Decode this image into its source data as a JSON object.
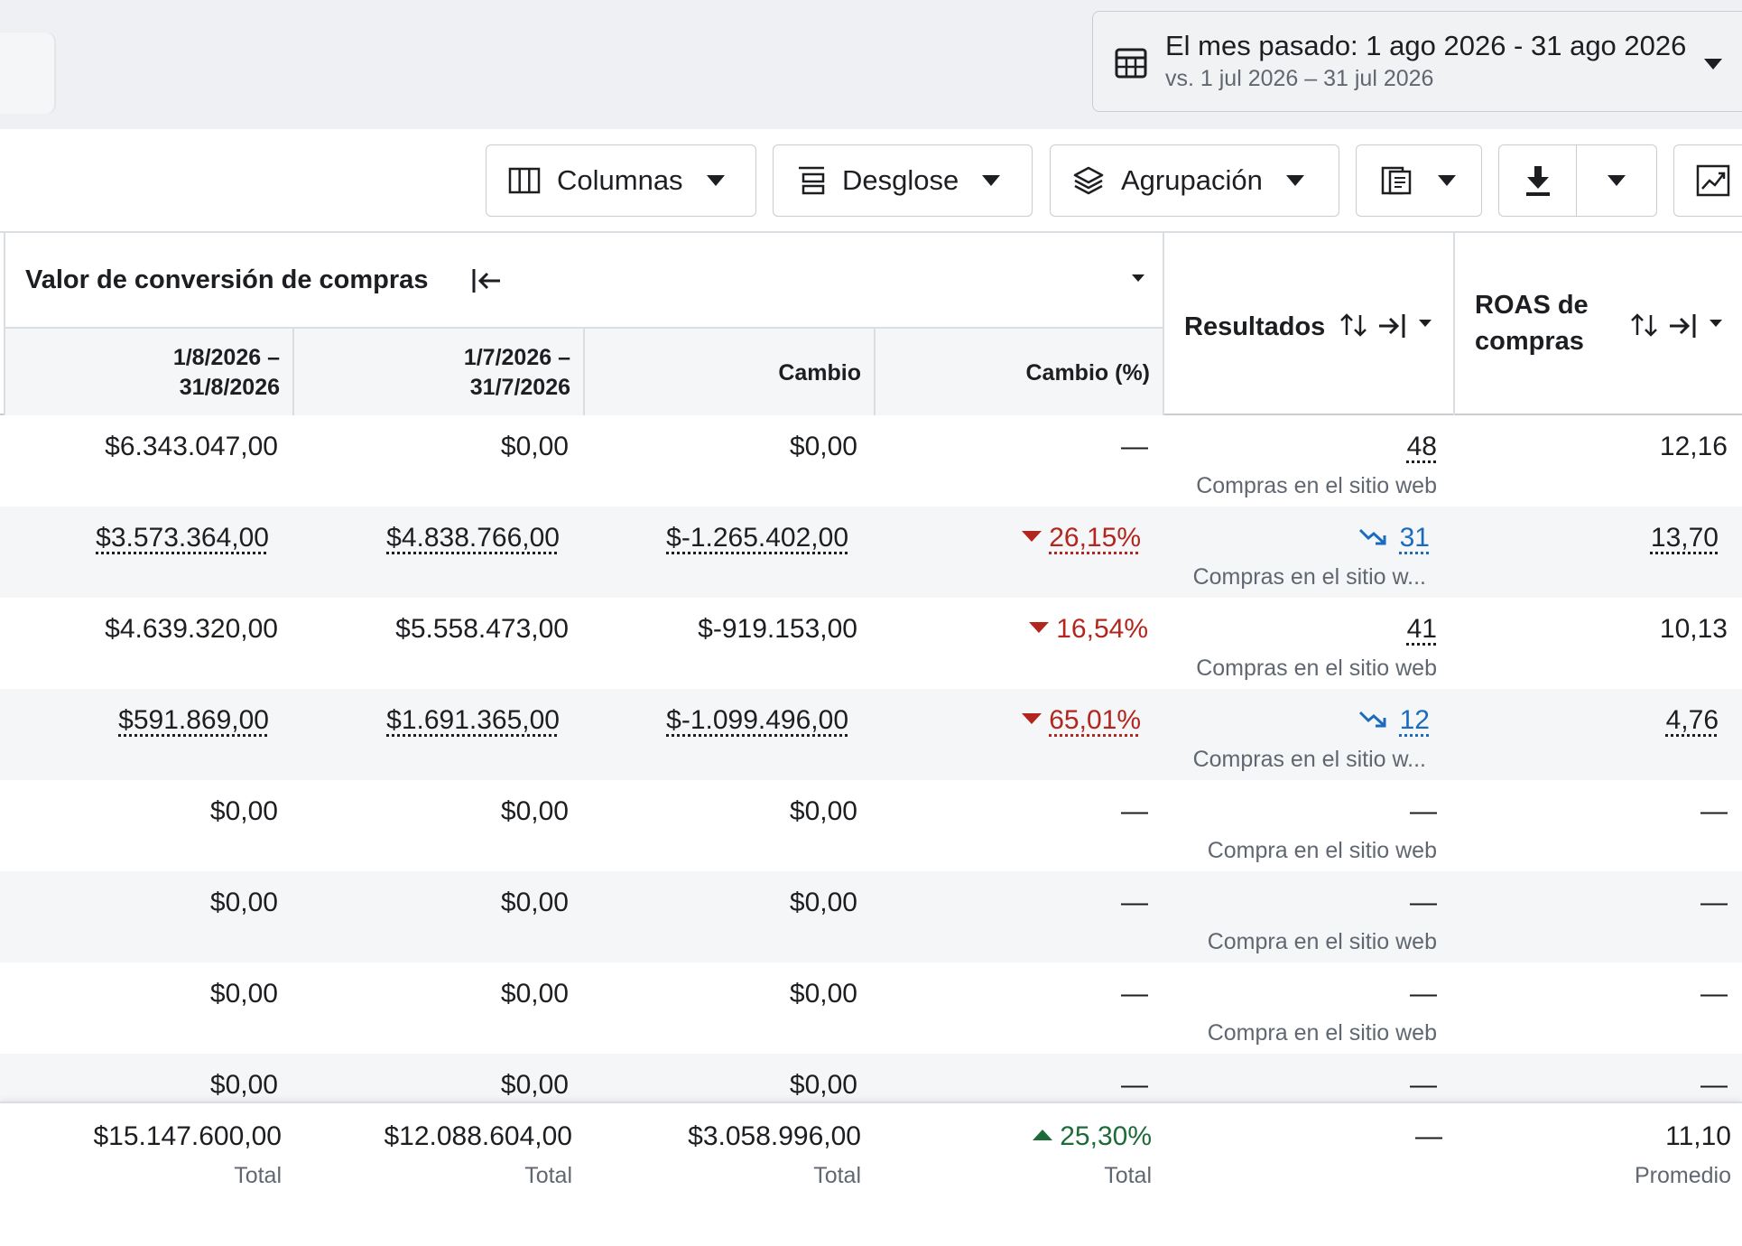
{
  "date_range": {
    "title": "El mes pasado: 1 ago 2026 - 31 ago 2026",
    "comparison": "vs. 1 jul 2026 – 31 jul 2026",
    "icon": "calendar-icon"
  },
  "toolbar": {
    "columns_label": "Columnas",
    "breakdown_label": "Desglose",
    "grouping_label": "Agrupación"
  },
  "table": {
    "group_title": "Valor de conversión de compras",
    "sub_headers": [
      "1/8/2026 – 31/8/2026",
      "1/7/2026 – 31/7/2026",
      "Cambio",
      "Cambio (%)"
    ],
    "sub_header_lines": [
      [
        "1/8/2026 –",
        "31/8/2026"
      ],
      [
        "1/7/2026 –",
        "31/7/2026"
      ],
      [
        "Cambio"
      ],
      [
        "Cambio (%)"
      ]
    ],
    "results_header": "Resultados",
    "roas_header": [
      "ROAS de",
      "compras"
    ],
    "rows": [
      {
        "current": "$6.343.047,00",
        "previous": "$0,00",
        "change": "$0,00",
        "change_pct": "—",
        "results": "48",
        "results_sub": "Compras en el sitio web",
        "roas": "12,16"
      },
      {
        "current": "$3.573.364,00",
        "previous": "$4.838.766,00",
        "change": "$-1.265.402,00",
        "change_pct": "26,15%",
        "results": "31",
        "results_sub": "Compras en el sitio w...",
        "roas": "13,70"
      },
      {
        "current": "$4.639.320,00",
        "previous": "$5.558.473,00",
        "change": "$-919.153,00",
        "change_pct": "16,54%",
        "results": "41",
        "results_sub": "Compras en el sitio web",
        "roas": "10,13"
      },
      {
        "current": "$591.869,00",
        "previous": "$1.691.365,00",
        "change": "$-1.099.496,00",
        "change_pct": "65,01%",
        "results": "12",
        "results_sub": "Compras en el sitio w...",
        "roas": "4,76"
      },
      {
        "current": "$0,00",
        "previous": "$0,00",
        "change": "$0,00",
        "change_pct": "—",
        "results": "—",
        "results_sub": "Compra en el sitio web",
        "roas": "—"
      },
      {
        "current": "$0,00",
        "previous": "$0,00",
        "change": "$0,00",
        "change_pct": "—",
        "results": "—",
        "results_sub": "Compra en el sitio web",
        "roas": "—"
      },
      {
        "current": "$0,00",
        "previous": "$0,00",
        "change": "$0,00",
        "change_pct": "—",
        "results": "—",
        "results_sub": "Compra en el sitio web",
        "roas": "—"
      },
      {
        "current": "$0,00",
        "previous": "$0,00",
        "change": "$0,00",
        "change_pct": "—",
        "results": "—",
        "results_sub": "",
        "roas": "—"
      }
    ],
    "totals": {
      "current": "$15.147.600,00",
      "current_label": "Total",
      "previous": "$12.088.604,00",
      "previous_label": "Total",
      "change": "$3.058.996,00",
      "change_label": "Total",
      "change_pct": "25,30%",
      "change_pct_label": "Total",
      "results": "—",
      "roas": "11,10",
      "roas_label": "Promedio"
    }
  },
  "colors": {
    "negative": "#b3261e",
    "positive": "#1e6b3a",
    "link": "#1a6bbf"
  }
}
